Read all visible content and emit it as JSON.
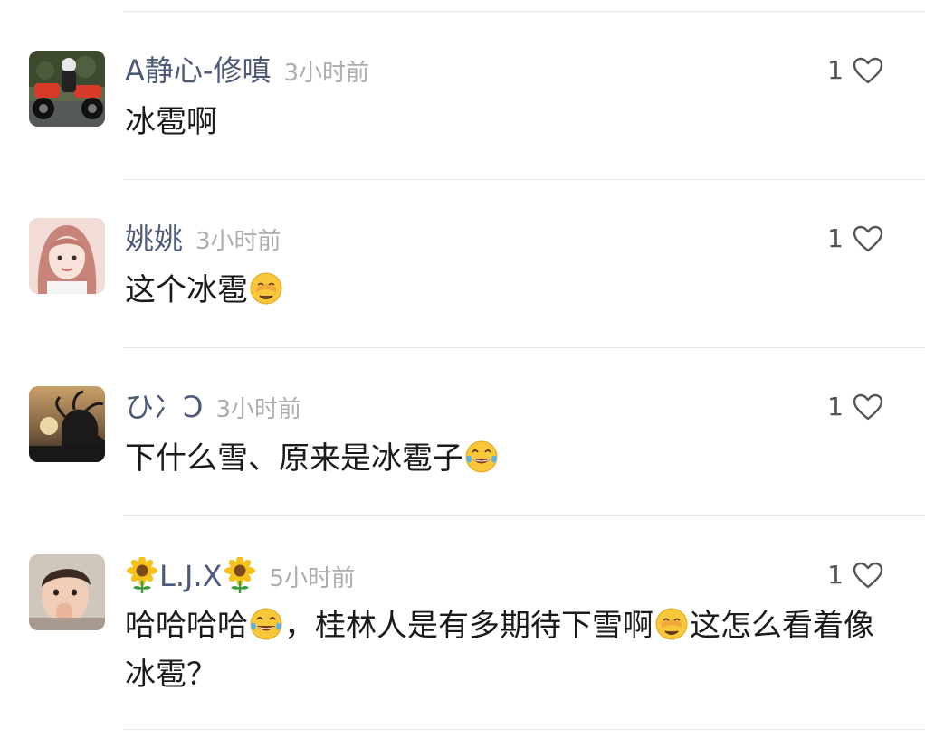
{
  "colors": {
    "username": "#4e5b78",
    "timestamp": "#adadad",
    "text": "#1a1a1a",
    "divider": "#e6e6e6",
    "heart": "#555555"
  },
  "comments": [
    {
      "username": "A静心-修嗔",
      "time": "3小时前",
      "likes": "1",
      "avatar_icon": "motorcycle-rider-avatar",
      "text_parts": [
        "冰雹啊"
      ]
    },
    {
      "username": "姚姚",
      "time": "3小时前",
      "likes": "1",
      "avatar_icon": "girl-portrait-avatar",
      "text_parts": [
        "这个冰雹"
      ],
      "emoji": "face-with-hand-over-eyes-emoji"
    },
    {
      "username": "ひ冫Ͻ",
      "time": "3小时前",
      "likes": "1",
      "avatar_icon": "sunset-silhouette-avatar",
      "text_parts": [
        "下什么雪、原来是冰雹子"
      ],
      "emoji": "tears-of-joy-emoji"
    },
    {
      "username": "L.J.X",
      "username_decoration": "sunflower-icon",
      "time": "5小时前",
      "likes": "1",
      "avatar_icon": "child-photo-avatar",
      "text_parts": [
        "哈哈哈哈",
        "，桂林人是有多期待下雪啊",
        "这怎么看着像冰雹？"
      ],
      "emojis": [
        "tears-of-joy-emoji",
        "face-with-hand-over-eyes-emoji"
      ]
    }
  ]
}
